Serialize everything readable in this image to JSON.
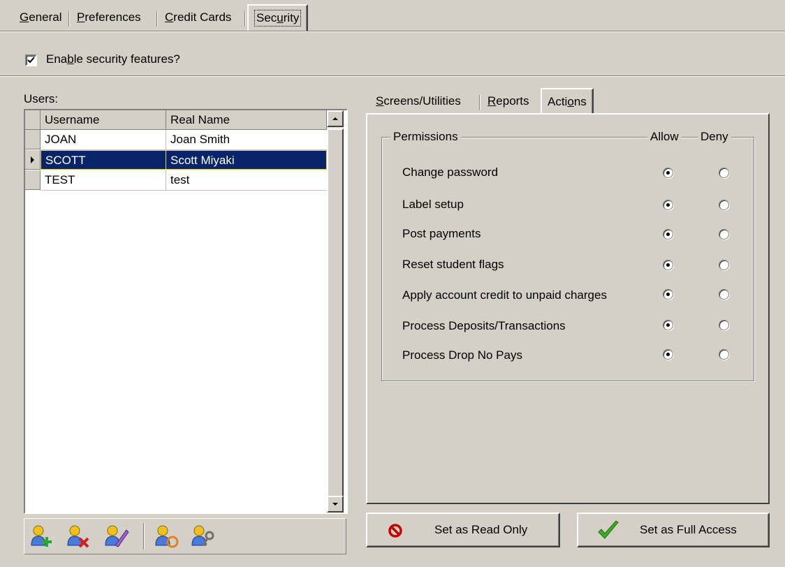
{
  "tabs": [
    "General",
    "Preferences",
    "Credit Cards",
    "Security"
  ],
  "enable_security": {
    "label": "Enable security features?",
    "checked": true
  },
  "users": {
    "label": "Users:",
    "columns": [
      "Username",
      "Real Name"
    ],
    "rows": [
      {
        "username": "JOAN",
        "real_name": "Joan Smith"
      },
      {
        "username": "SCOTT",
        "real_name": "Scott Miyaki"
      },
      {
        "username": "TEST",
        "real_name": "test"
      }
    ],
    "selected_index": 1
  },
  "toolbar_icons": [
    "add-user-icon",
    "delete-user-icon",
    "edit-user-icon",
    "copy-user-icon",
    "user-password-icon"
  ],
  "sub_tabs": [
    "Screens/Utilities",
    "Reports",
    "Actions"
  ],
  "permissions": {
    "group_label": "Permissions",
    "allow_label": "Allow",
    "deny_label": "Deny",
    "items": [
      {
        "label": "Change password",
        "value": "allow"
      },
      {
        "label": "Label setup",
        "value": "allow"
      },
      {
        "label": "Post payments",
        "value": "allow"
      },
      {
        "label": "Reset student flags",
        "value": "allow"
      },
      {
        "label": "Apply account credit to unpaid charges",
        "value": "allow"
      },
      {
        "label": "Process Deposits/Transactions",
        "value": "allow"
      },
      {
        "label": "Process Drop No Pays",
        "value": "allow"
      }
    ]
  },
  "buttons": {
    "read_only": "Set as Read Only",
    "full_access": "Set as Full Access"
  },
  "colors": {
    "selection": "#0a246a",
    "face": "#d4d0c8",
    "check_green": "#3cae2a",
    "stop_red": "#c80000"
  }
}
